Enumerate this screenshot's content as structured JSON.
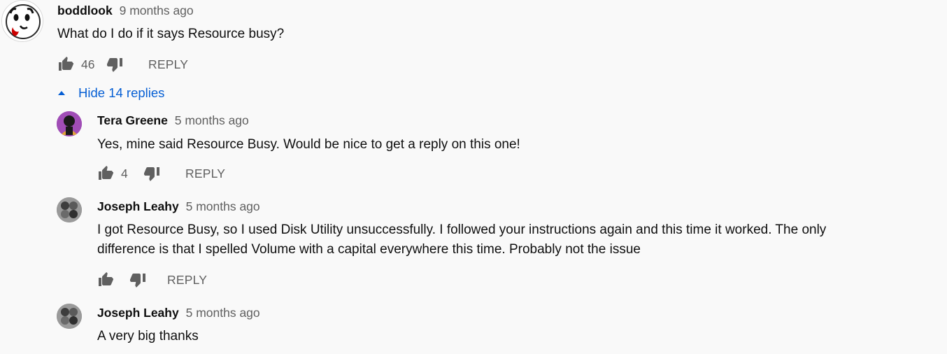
{
  "comments": [
    {
      "author": "boddlook",
      "time": "9 months ago",
      "text": "What do I do if it says Resource busy?",
      "likes": "46",
      "reply_label": "REPLY",
      "toggle_label": "Hide 14 replies"
    },
    {
      "author": "Tera Greene",
      "time": "5 months ago",
      "text": "Yes, mine said Resource Busy.  Would be nice to get a reply on this one!",
      "likes": "4",
      "reply_label": "REPLY"
    },
    {
      "author": "Joseph Leahy",
      "time": "5 months ago",
      "text_lines": [
        "I got Resource Busy, so I used Disk Utility unsuccessfully. I followed your instructions again and this time it worked. The only",
        "difference is that I spelled Volume with a capital everywhere this time. Probably not the issue"
      ],
      "likes": "",
      "reply_label": "REPLY"
    },
    {
      "author": "Joseph Leahy",
      "time": "5 months ago",
      "text": "A very big thanks"
    }
  ],
  "colors": {
    "background": "#f9f9f9",
    "primary_text": "#0f0f0f",
    "secondary_text": "#606060",
    "accent_blue": "#065fd4"
  },
  "icons": {
    "like": "thumb-up-icon",
    "dislike": "thumb-down-icon",
    "toggle": "caret-up-icon"
  }
}
